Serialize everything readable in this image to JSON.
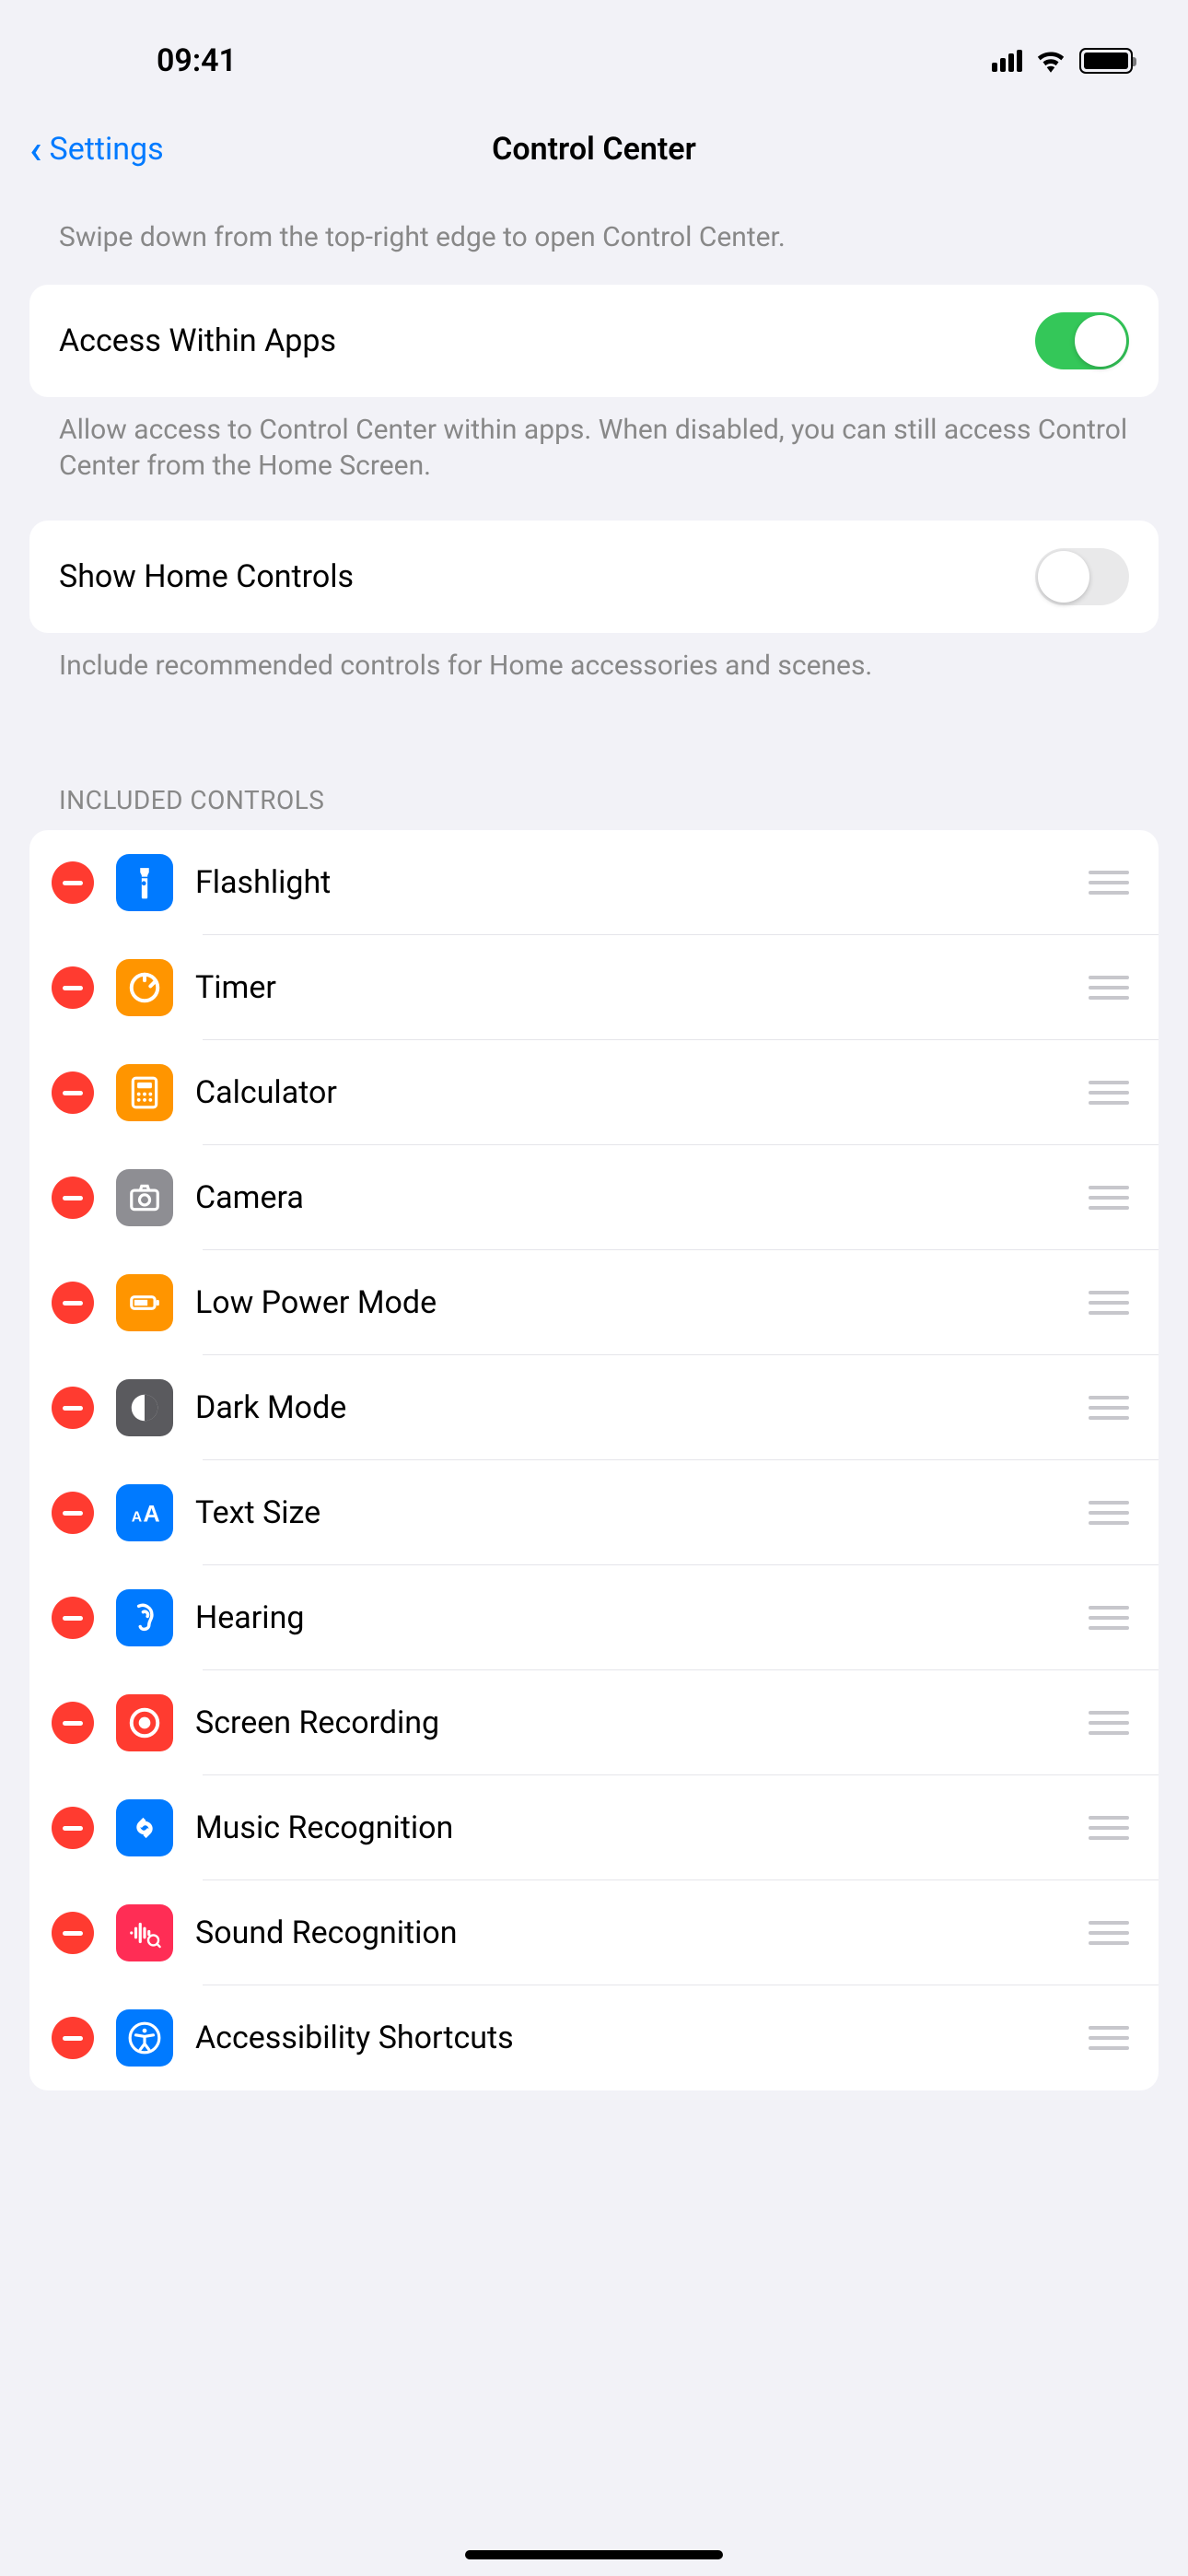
{
  "status": {
    "time": "09:41"
  },
  "nav": {
    "back_label": "Settings",
    "title": "Control Center"
  },
  "intro": "Swipe down from the top-right edge to open Control Center.",
  "access": {
    "label": "Access Within Apps",
    "footer": "Allow access to Control Center within apps. When disabled, you can still access Control Center from the Home Screen.",
    "enabled": true
  },
  "home": {
    "label": "Show Home Controls",
    "footer": "Include recommended controls for Home accessories and scenes.",
    "enabled": false
  },
  "included": {
    "header": "INCLUDED CONTROLS",
    "items": [
      {
        "label": "Flashlight",
        "icon": "flashlight",
        "bg": "bg-blue"
      },
      {
        "label": "Timer",
        "icon": "timer",
        "bg": "bg-orange"
      },
      {
        "label": "Calculator",
        "icon": "calculator",
        "bg": "bg-orange"
      },
      {
        "label": "Camera",
        "icon": "camera",
        "bg": "bg-gray"
      },
      {
        "label": "Low Power Mode",
        "icon": "battery",
        "bg": "bg-orange"
      },
      {
        "label": "Dark Mode",
        "icon": "darkmode",
        "bg": "bg-darkgray"
      },
      {
        "label": "Text Size",
        "icon": "textsize",
        "bg": "bg-blue"
      },
      {
        "label": "Hearing",
        "icon": "ear",
        "bg": "bg-blue"
      },
      {
        "label": "Screen Recording",
        "icon": "record",
        "bg": "bg-red"
      },
      {
        "label": "Music Recognition",
        "icon": "shazam",
        "bg": "bg-blue"
      },
      {
        "label": "Sound Recognition",
        "icon": "sound",
        "bg": "bg-pink"
      },
      {
        "label": "Accessibility Shortcuts",
        "icon": "accessibility",
        "bg": "bg-blue"
      }
    ]
  }
}
